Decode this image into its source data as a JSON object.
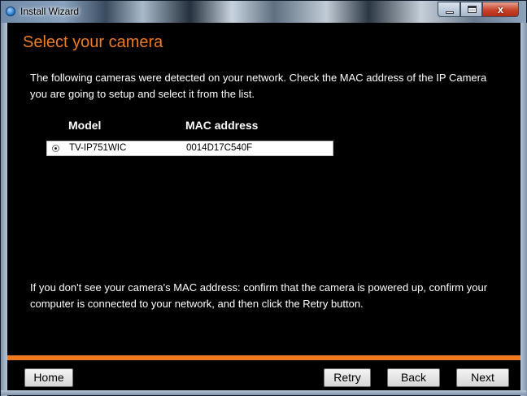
{
  "window": {
    "title": "Install Wizard",
    "controls": {
      "minimize": "minimize",
      "maximize": "maximize",
      "close": "x"
    }
  },
  "page": {
    "heading": "Select your camera",
    "intro": "The following cameras were detected on your network. Check the MAC address of the IP Camera you are going to setup and select it from the list.",
    "hint": "If you don't see your camera's MAC address: confirm that the camera is powered up, confirm your computer is connected to your network, and then click the Retry button."
  },
  "camera_list": {
    "columns": {
      "model": "Model",
      "mac": "MAC address"
    },
    "rows": [
      {
        "model": "TV-IP751WIC",
        "mac": "0014D17C540F",
        "selected": true
      }
    ]
  },
  "footer": {
    "home_label": "Home",
    "retry_label": "Retry",
    "back_label": "Back",
    "next_label": "Next"
  },
  "colors": {
    "accent": "#f07a20",
    "background": "#000000",
    "text": "#ffffff"
  }
}
